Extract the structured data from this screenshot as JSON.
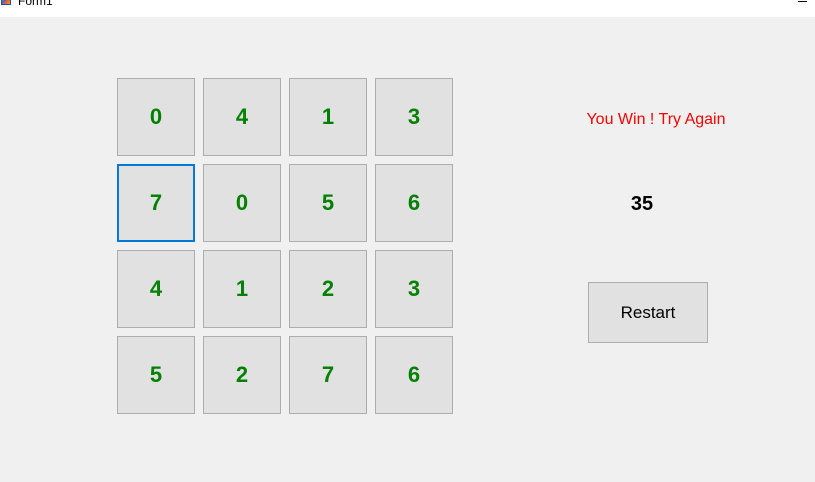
{
  "window": {
    "title": "Form1"
  },
  "board": {
    "rows": [
      [
        "0",
        "4",
        "1",
        "3"
      ],
      [
        "7",
        "0",
        "5",
        "6"
      ],
      [
        "4",
        "1",
        "2",
        "3"
      ],
      [
        "5",
        "2",
        "7",
        "6"
      ]
    ],
    "tile_text_color": "#008000",
    "focused_tile": {
      "row": 2,
      "col": 1
    }
  },
  "status": {
    "message": "You Win ! Try Again",
    "color": "#ff0000"
  },
  "counter": {
    "value": "35"
  },
  "controls": {
    "restart_label": "Restart"
  },
  "icons": {
    "app": "app-icon",
    "minimize": "minimize-icon"
  }
}
